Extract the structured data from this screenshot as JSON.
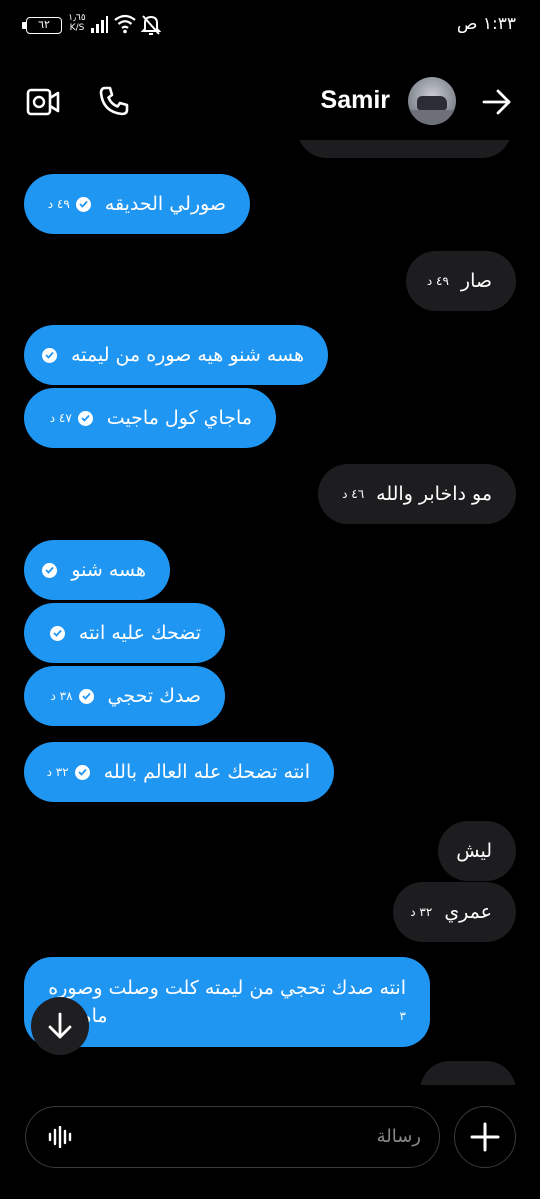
{
  "status_bar": {
    "battery": "٦٢",
    "net_speed_value": "١٫٦٥",
    "net_speed_unit": "K/S",
    "time": "١:٣٣ ص",
    "icons": [
      "signal-icon",
      "wifi-icon",
      "bell-muted-icon"
    ]
  },
  "header": {
    "contact_name": "Samir",
    "icons": [
      "video-call-icon",
      "phone-call-icon",
      "back-arrow-icon"
    ]
  },
  "messages": [
    {
      "side": "sent",
      "text": "صورلي الحديقه",
      "time": "٤٩ د",
      "read": true
    },
    {
      "side": "recv",
      "text": "صار",
      "time": "٤٩ د"
    },
    {
      "side": "sent",
      "text": "هسه شنو هيه صوره من ليمته",
      "time": "",
      "read": true
    },
    {
      "side": "sent",
      "text": "ماجاي كول ماجيت",
      "time": "٤٧ د",
      "read": true
    },
    {
      "side": "recv",
      "text": "مو داخابر والله",
      "time": "٤٦ د"
    },
    {
      "side": "sent",
      "text": "هسه شنو",
      "time": "",
      "read": true
    },
    {
      "side": "sent",
      "text": "تضحك عليه انته",
      "time": "",
      "read": true
    },
    {
      "side": "sent",
      "text": "صدك تحجي",
      "time": "٣٨ د",
      "read": true
    },
    {
      "side": "sent",
      "text": "انته تضحك عله العالم بالله",
      "time": "٣٢ د",
      "read": true
    },
    {
      "side": "recv",
      "text": "ليش",
      "time": ""
    },
    {
      "side": "recv",
      "text": "عمري",
      "time": "٣٢ د"
    },
    {
      "side": "sent",
      "lines": [
        "انته صدك تحجي من ليمته كلت وصلت وصوره",
        "مامصور"
      ],
      "time": "٣"
    }
  ],
  "composer": {
    "placeholder": "رسالة",
    "icons": [
      "voice-wave-icon",
      "plus-icon"
    ]
  },
  "scroll_fab_icon": "arrow-down-icon",
  "colors": {
    "background": "#000000",
    "sent_bubble": "#2096f3",
    "received_bubble": "#1d1d1f",
    "text": "#ffffff"
  }
}
